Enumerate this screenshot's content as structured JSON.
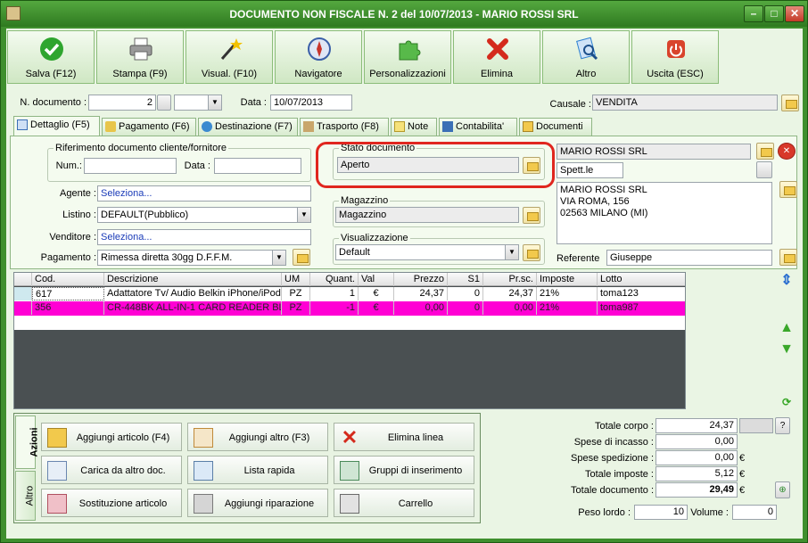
{
  "window": {
    "title": "DOCUMENTO NON FISCALE N. 2 del 10/07/2013 - MARIO ROSSI SRL",
    "min": "–",
    "max": "□",
    "close": "✕"
  },
  "toolbar": [
    {
      "name": "salva-button",
      "label": "Salva (F12)",
      "icon": "check-icon",
      "color": "#2fa52f"
    },
    {
      "name": "stampa-button",
      "label": "Stampa (F9)",
      "icon": "printer-icon",
      "color": "#777777"
    },
    {
      "name": "visual-button",
      "label": "Visual. (F10)",
      "icon": "magic-wand-icon",
      "color": "#d4a017"
    },
    {
      "name": "navigatore-button",
      "label": "Navigatore",
      "icon": "compass-icon",
      "color": "#3a5fa8"
    },
    {
      "name": "personalizzazioni-button",
      "label": "Personalizzazioni",
      "icon": "puzzle-icon",
      "color": "#58b94a"
    },
    {
      "name": "elimina-button",
      "label": "Elimina",
      "icon": "x-icon",
      "color": "#d42a1c"
    },
    {
      "name": "altro-button",
      "label": "Altro",
      "icon": "search-doc-icon",
      "color": "#2c7fd0"
    },
    {
      "name": "uscita-button",
      "label": "Uscita (ESC)",
      "icon": "power-icon",
      "color": "#d9432c"
    }
  ],
  "header": {
    "ndoc_label": "N. documento :",
    "ndoc_value": "2",
    "data_label": "Data :",
    "data_value": "10/07/2013",
    "causale_label": "Causale :",
    "causale_value": "VENDITA"
  },
  "tabs": [
    "Dettaglio (F5)",
    "Pagamento (F6)",
    "Destinazione (F7)",
    "Trasporto (F8)",
    "Note",
    "Contabilita'",
    "Documenti"
  ],
  "riferimento": {
    "title": "Riferimento documento cliente/fornitore",
    "num_label": "Num.:",
    "data_label": "Data :"
  },
  "agente": {
    "label": "Agente :",
    "value": "Seleziona..."
  },
  "listino": {
    "label": "Listino :",
    "value": "DEFAULT(Pubblico)"
  },
  "venditore": {
    "label": "Venditore :",
    "value": "Seleziona..."
  },
  "pagamento": {
    "label": "Pagamento :",
    "value": "Rimessa diretta 30gg D.F.F.M."
  },
  "stato": {
    "title": "Stato documento",
    "value": "Aperto"
  },
  "magazzino": {
    "title": "Magazzino",
    "value": "Magazzino"
  },
  "visualizzazione": {
    "title": "Visualizzazione",
    "value": "Default"
  },
  "cliente": {
    "name": "MARIO ROSSI SRL",
    "spett": "Spett.le",
    "address": [
      "MARIO ROSSI SRL",
      "VIA ROMA, 156",
      "02563 MILANO (MI)"
    ],
    "referente_label": "Referente",
    "referente_value": "Giuseppe"
  },
  "table": {
    "columns": [
      "Cod.",
      "Descrizione",
      "UM",
      "Quant.",
      "Val",
      "Prezzo",
      "S1",
      "Pr.sc.",
      "Imposte",
      "Lotto"
    ],
    "rows": [
      [
        "617",
        "Adattatore Tv/ Audio Belkin iPhone/iPod",
        "PZ",
        "1",
        "€",
        "24,37",
        "0",
        "24,37",
        "21%",
        "toma123"
      ],
      [
        "356",
        "CR-448BK ALL-IN-1 CARD READER BL...",
        "PZ",
        "-1",
        "€",
        "0,00",
        "0",
        "0,00",
        "21%",
        "toma987"
      ]
    ]
  },
  "actions": {
    "tab_azioni": "Azioni",
    "tab_altro": "Altro",
    "buttons": [
      "Aggiungi articolo (F4)",
      "Aggiungi altro (F3)",
      "Elimina linea",
      "Carica da altro doc.",
      "Lista rapida",
      "Gruppi di inserimento",
      "Sostituzione articolo",
      "Aggiungi riparazione",
      "Carrello"
    ]
  },
  "totals": {
    "corpo_label": "Totale corpo :",
    "corpo_value": "24,37",
    "incasso_label": "Spese di incasso :",
    "incasso_value": "0,00",
    "spedizione_label": "Spese spedizione :",
    "spedizione_value": "0,00",
    "imposte_label": "Totale imposte :",
    "imposte_value": "5,12",
    "documento_label": "Totale documento :",
    "documento_value": "29,49",
    "euro": "€",
    "help": "?",
    "peso_label": "Peso lordo :",
    "peso_value": "10",
    "volume_label": "Volume :",
    "volume_value": "0"
  }
}
